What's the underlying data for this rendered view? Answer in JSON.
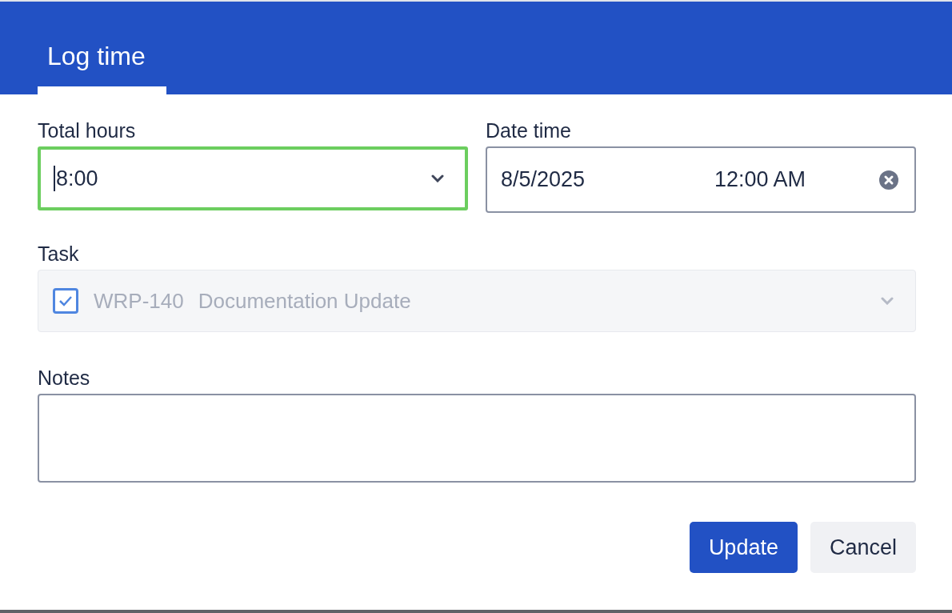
{
  "tabs": [
    {
      "label": "Log time",
      "selected": true
    }
  ],
  "total_hours": {
    "label": "Total hours",
    "value": "8:00",
    "focused": true
  },
  "date_time": {
    "label": "Date time",
    "date": "8/5/2025",
    "time": "12:00 AM"
  },
  "task": {
    "label": "Task",
    "key": "WRP-140",
    "name": "Documentation Update",
    "checked": true,
    "disabled": true
  },
  "notes": {
    "label": "Notes"
  },
  "buttons": [
    {
      "label": "Update",
      "kind": "primary"
    },
    {
      "label": "Cancel",
      "kind": "secondary"
    }
  ]
}
